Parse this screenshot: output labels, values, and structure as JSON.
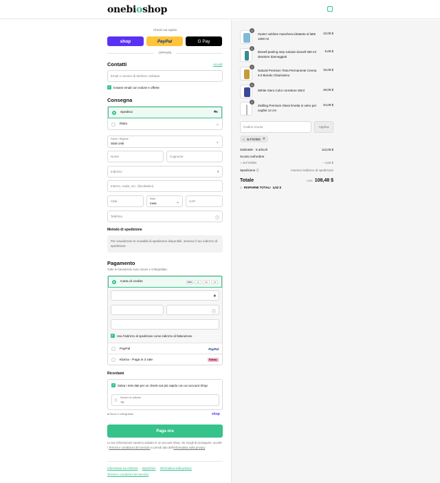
{
  "brand": {
    "name_part1": "onebi",
    "name_accent": "o",
    "name_part2": "shop"
  },
  "express": {
    "label": "Check-out rapido",
    "shop": "shop",
    "paypal": "PayPal",
    "gpay": "G Pay",
    "separator": "OPPURE"
  },
  "contact": {
    "title": "Contatti",
    "login_link": "Accedi",
    "email_placeholder": "Email o numero di telefono cellulare",
    "newsletter_label": "Inviami email con notizie e offerte"
  },
  "delivery": {
    "title": "Consegna",
    "options": [
      {
        "label": "Spedisci",
        "icon": "truck-icon"
      },
      {
        "label": "Ritiro",
        "icon": "store-icon"
      }
    ],
    "country_label": "Paese / Regione",
    "country_value": "Stati Uniti",
    "first_name_placeholder": "Nome",
    "last_name_placeholder": "Cognome",
    "address_placeholder": "Indirizzo",
    "address2_placeholder": "Interno, scala, ecc. (facoltativo)",
    "city_placeholder": "Città",
    "state_label": "Stato",
    "state_value": "Iowa",
    "zip_placeholder": "CAP",
    "phone_placeholder": "Telefono"
  },
  "shipping_method": {
    "title": "Metodo di spedizione",
    "note": "Per visualizzare le modalità di spedizione disponibili, inserisci il tuo indirizzo di spedizione."
  },
  "payment": {
    "title": "Pagamento",
    "subtitle": "Tutte le transazioni sono sicure e crittografate.",
    "credit_card_label": "Carta di credito",
    "card_brands": [
      "VISA",
      "MAESTRO",
      "MASTERCARD",
      "+3"
    ],
    "billing_same_label": "Usa l'indirizzo di spedizione come indirizzo di fatturazione",
    "paypal_label": "PayPal",
    "paypal_logo": "PayPal",
    "klarna_label": "Klarna - Paga in 3 rate",
    "klarna_logo": "Klarna."
  },
  "remember": {
    "title": "Ricordami",
    "save_label": "Salva i miei dati per un check-out più rapido con un account Shop",
    "phone_label": "Numero di cellulare",
    "phone_value": "+1",
    "secure_note": "Sicuro e crittografato",
    "shop_logo": "shop"
  },
  "pay_button": "Paga ora",
  "legal": {
    "text1": "Le tue informazioni saranno salvate in un account Shop. Se scegli di proseguire, accetti i",
    "terms_link": "Termini e condizioni del servizio",
    "text2": "e prendi atto dell'",
    "privacy_link": "Informativa sulla privacy",
    "text3": "."
  },
  "footer_links": [
    "Informativa sui rimborsi",
    "Spedizioni",
    "Informativa sulla privacy",
    "Termini e condizioni del servizio"
  ],
  "cart": {
    "items": [
      {
        "qty": "1",
        "name": "Oyster sublime maschera idratante al latte 1000 ml",
        "price": "10,05 $",
        "color": "#7fb9d8"
      },
      {
        "qty": "1",
        "name": "Bionell peeling stop solution bionell 300 ml desatore danneggiati",
        "price": "5,09 $",
        "color": "#3a8a8e"
      },
      {
        "qty": "1",
        "name": "Natural Premium Tinta Permanente Crema 9.0 Biondo Chiarissimo",
        "price": "15,09 $",
        "color": "#c79b3a"
      },
      {
        "qty": "1",
        "name": "iWhite Siero Color correttore 30ml",
        "price": "49,05 $",
        "color": "#3a4a9a"
      },
      {
        "qty": "1",
        "name": "Zwilling Premium Glass limetta in vetro per unghie 14 cm",
        "price": "34,09 $",
        "color": "#b7b7b7"
      }
    ],
    "discount_placeholder": "Codice sconto",
    "apply_button": "Applica",
    "applied_code": "4LFSOBS",
    "subtotal_label": "Subtotale · 5 articoli",
    "subtotal_value": "113,06 $",
    "order_discount_label": "Sconto sull'ordine",
    "order_discount_code": "4LFSOBS",
    "order_discount_value": "− 4,52 $",
    "shipping_label": "Spedizione",
    "shipping_value": "Inserisci indirizzo di spedizione",
    "total_label": "Totale",
    "total_currency": "USD",
    "total_value": "108,48 $",
    "savings_label": "RISPARMI TOTALI",
    "savings_value": "4,52 $"
  }
}
